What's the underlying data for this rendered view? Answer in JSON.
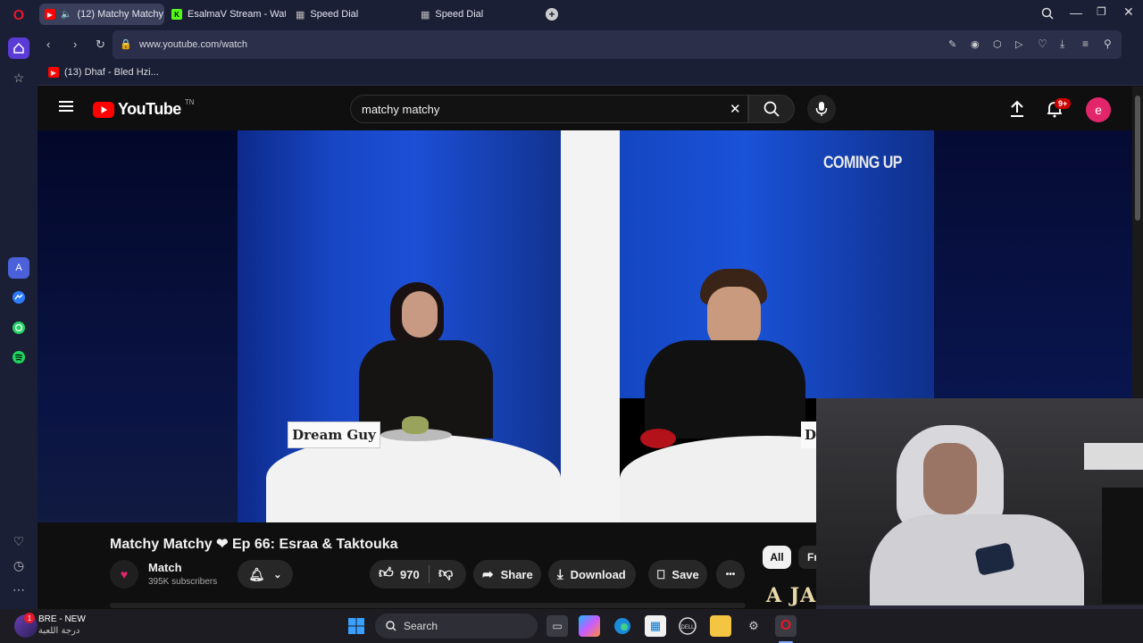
{
  "browser": {
    "tabs": [
      {
        "label": "(12) Matchy Matchy",
        "active": true
      },
      {
        "label": "EsalmaV Stream - Watch L"
      },
      {
        "label": "Speed Dial"
      },
      {
        "label": "Speed Dial"
      }
    ],
    "new_tab_symbol": "+",
    "url": "www.youtube.com/watch",
    "bookmark": "(13) Dhaf - Bled Hzi..."
  },
  "youtube": {
    "logo_text": "YouTube",
    "country_code": "TN",
    "search_value": "matchy matchy",
    "notification_badge": "9+",
    "avatar_letter": "e",
    "video": {
      "overlay_text": "COMING UP",
      "name_card_1": "Dream Guy",
      "name_card_2": "Dr",
      "title": "Matchy Matchy ❤ Ep 66: Esraa & Taktouka",
      "channel": "Match",
      "subscribers": "395K subscribers",
      "likes": "970",
      "share_label": "Share",
      "download_label": "Download",
      "save_label": "Save",
      "more_label": "•••"
    },
    "chips": [
      "All",
      "Fr"
    ]
  },
  "webcam": {
    "thumb_text": "A JA"
  },
  "taskbar": {
    "weather_badge": "1",
    "weather_title": "BRE - NEW",
    "weather_subtitle": "درجة اللعبة",
    "search_label": "Search"
  },
  "colors": {
    "youtube_red": "#ff0000",
    "avatar_pink": "#e3266b",
    "opera_red": "#e4182b",
    "sidebar_bg": "#1b1f36"
  }
}
